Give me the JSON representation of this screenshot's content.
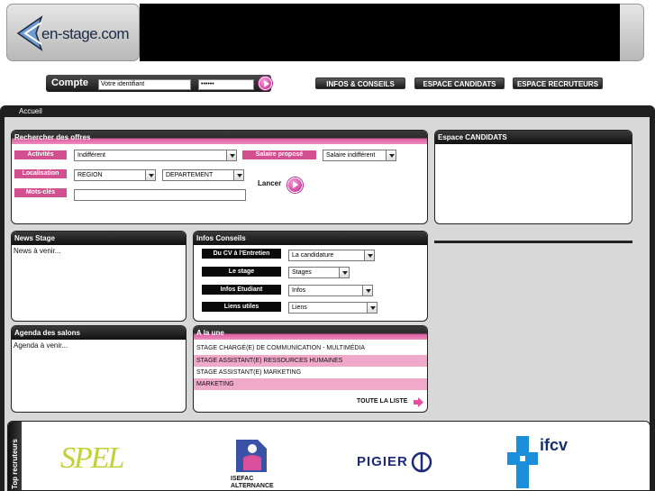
{
  "header": {
    "logo_text": "en-stage.com"
  },
  "login": {
    "label": "Compte",
    "user_value": "Votre identifiant",
    "password_mask": "••••••"
  },
  "nav": {
    "infos": "INFOS & CONSEILS",
    "candidats": "ESPACE CANDIDATS",
    "recruteurs": "ESPACE RECRUTEURS"
  },
  "breadcrumb": "Accueil",
  "search": {
    "title": "Rechercher des offres",
    "activites_label": "Activités",
    "activites_value": "Indifférent",
    "salaire_label": "Salaire proposé",
    "salaire_value": "Salaire indifférent",
    "localisation_label": "Localisation",
    "region_value": "REGION",
    "departement_value": "DEPARTEMENT",
    "motscles_label": "Mots-clés",
    "lancer": "Lancer"
  },
  "espace_candidats": {
    "title": "Espace CANDIDATS"
  },
  "news": {
    "title": "News Stage",
    "body": "News à venir..."
  },
  "infos_conseils": {
    "title": "Infos Conseils",
    "rows": [
      {
        "label": "Du CV à l'Entretien",
        "value": "La candidature"
      },
      {
        "label": "Le stage",
        "value": "Stages"
      },
      {
        "label": "Infos Etudiant",
        "value": "Infos"
      },
      {
        "label": "Liens utiles",
        "value": "Liens"
      }
    ]
  },
  "agenda": {
    "title": "Agenda des salons",
    "body": "Agenda à venir..."
  },
  "a_la_une": {
    "title": "A la une",
    "items": [
      "STAGE CHARGÉ(E) DE COMMUNICATION - MULTIMÉDIA",
      "STAGE ASSISTANT(E) RESSOURCES HUMAINES",
      "STAGE ASSISTANT(E) MARKETING",
      "MARKETING"
    ],
    "toute_la_liste": "TOUTE LA LISTE"
  },
  "recruteurs": {
    "side_label": "Top recruteurs",
    "logos": [
      "SPEL",
      "ISEFAC ALTERNANCE",
      "PIGIER",
      "ifcv"
    ]
  },
  "colors": {
    "accent_pink": "#d2508f",
    "dark": "#1f1f1f"
  }
}
